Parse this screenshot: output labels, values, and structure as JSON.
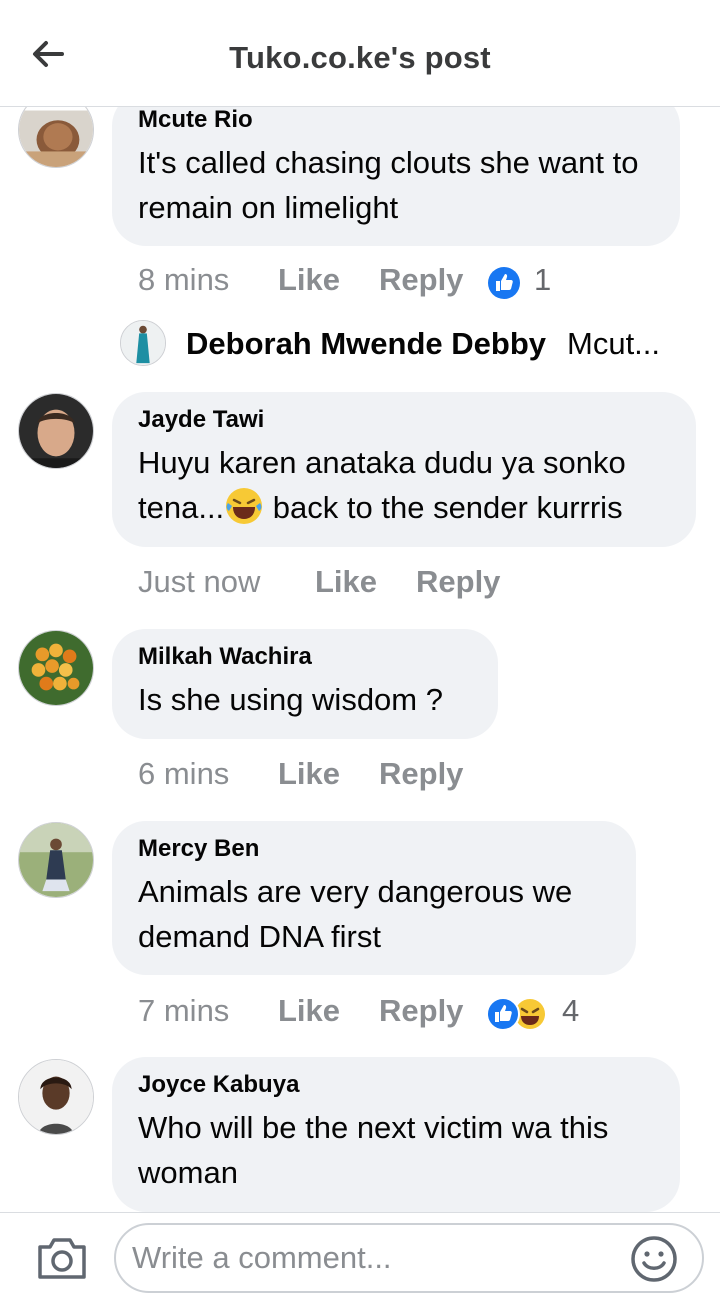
{
  "header": {
    "title": "Tuko.co.ke's post",
    "back_icon": "arrow-left-icon"
  },
  "comments": [
    {
      "name": "Mcute Rio",
      "text": "It's called chasing clouts she want to remain on limelight",
      "time": "8 mins",
      "like": "Like",
      "reply": "Reply",
      "reaction_count": "1",
      "reactions": [
        "like"
      ]
    },
    {
      "name": "Jayde Tawi",
      "text_before": "Huyu karen anataka dudu ya sonko tena...",
      "text_after": " back to the sender kurrris",
      "time": "Just now",
      "like": "Like",
      "reply": "Reply"
    },
    {
      "name": "Milkah Wachira",
      "text": "Is she using wisdom ?",
      "time": "6 mins",
      "like": "Like",
      "reply": "Reply"
    },
    {
      "name": "Mercy Ben",
      "text": "Animals are very dangerous we demand DNA first",
      "time": "7 mins",
      "like": "Like",
      "reply": "Reply",
      "reaction_count": "4",
      "reactions": [
        "like",
        "haha"
      ]
    },
    {
      "name": "Joyce Kabuya",
      "text": "Who will be the next victim wa this woman"
    }
  ],
  "reply_preview": {
    "name": "Deborah Mwende Debby",
    "text": "Mcut..."
  },
  "composer": {
    "placeholder": "Write a comment...",
    "camera_icon": "camera-icon",
    "emoji_icon": "emoji-icon"
  },
  "colors": {
    "bubble": "#f0f2f5",
    "like_blue": "#1877f2",
    "meta_gray": "#8a8d91"
  }
}
